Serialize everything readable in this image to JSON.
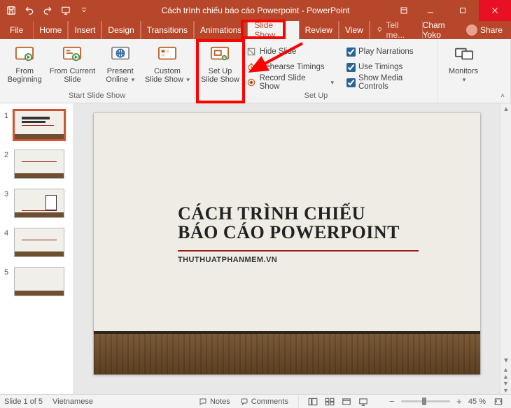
{
  "titlebar": {
    "document_title": "Cách trình chiếu báo cáo Powerpoint - PowerPoint"
  },
  "tabs": {
    "file": "File",
    "items": [
      "Home",
      "Insert",
      "Design",
      "Transitions",
      "Animations",
      "Slide Show",
      "Review",
      "View"
    ],
    "active_index": 5,
    "tell_me": "Tell me...",
    "user_name": "Cham Yoko",
    "share": "Share"
  },
  "ribbon": {
    "groups": {
      "start": {
        "label": "Start Slide Show",
        "from_beginning": "From Beginning",
        "from_current": "From Current Slide",
        "present_online": "Present Online",
        "custom_show": "Custom Slide Show"
      },
      "setup": {
        "label": "Set Up",
        "setup_btn": "Set Up Slide Show",
        "hide_slide": "Hide Slide",
        "rehearse": "Rehearse Timings",
        "record": "Record Slide Show",
        "play_narr": "Play Narrations",
        "use_timings": "Use Timings",
        "show_media": "Show Media Controls"
      },
      "monitors": {
        "label": "Monitors",
        "monitors_btn": "Monitors"
      }
    }
  },
  "thumbnails": {
    "count": 5,
    "selected": 1
  },
  "slide": {
    "title_line1": "CÁCH TRÌNH CHIẾU",
    "title_line2": "BÁO CÁO POWERPOINT",
    "subtitle": "THUTHUATPHANMEM.VN"
  },
  "statusbar": {
    "slide_of": "Slide 1 of 5",
    "language": "Vietnamese",
    "notes": "Notes",
    "comments": "Comments",
    "zoom_pct": "45 %"
  }
}
